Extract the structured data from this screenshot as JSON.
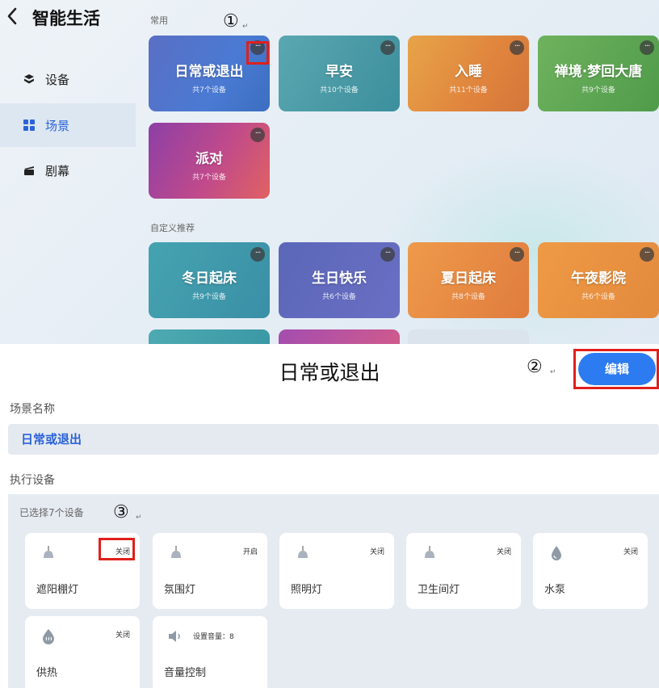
{
  "app": {
    "back_icon": "chevron-left-icon",
    "title": "智能生活"
  },
  "sidebar": {
    "items": [
      {
        "label": "设备",
        "icon": "devices-icon",
        "active": false
      },
      {
        "label": "场景",
        "icon": "scenes-grid-icon",
        "active": true
      },
      {
        "label": "剧幕",
        "icon": "theater-icon",
        "active": false
      }
    ]
  },
  "sections": {
    "common": "常用",
    "custom": "自定义推荐"
  },
  "common_scenes": [
    {
      "title": "日常或退出",
      "subtitle": "共7个设备"
    },
    {
      "title": "早安",
      "subtitle": "共10个设备"
    },
    {
      "title": "入睡",
      "subtitle": "共11个设备"
    },
    {
      "title": "禅境·梦回大唐",
      "subtitle": "共9个设备"
    },
    {
      "title": "派对",
      "subtitle": "共7个设备"
    }
  ],
  "custom_scenes": [
    {
      "title": "冬日起床",
      "subtitle": "共9个设备"
    },
    {
      "title": "生日快乐",
      "subtitle": "共6个设备"
    },
    {
      "title": "夏日起床",
      "subtitle": "共8个设备"
    },
    {
      "title": "午夜影院",
      "subtitle": "共6个设备"
    }
  ],
  "more_icon_text": "···",
  "annotations": {
    "step1": "①",
    "step2": "②",
    "step3": "③",
    "return_mark": "↵"
  },
  "detail": {
    "title": "日常或退出",
    "edit_label": "编辑",
    "scene_name_label": "场景名称",
    "scene_name_value": "日常或退出",
    "exec_devices_label": "执行设备",
    "selected_count": "已选择7个设备",
    "devices": [
      {
        "name": "遮阳棚灯",
        "state": "关闭",
        "icon": "bulb-icon"
      },
      {
        "name": "氛围灯",
        "state": "开启",
        "icon": "bulb-icon"
      },
      {
        "name": "照明灯",
        "state": "关闭",
        "icon": "bulb-icon"
      },
      {
        "name": "卫生间灯",
        "state": "关闭",
        "icon": "bulb-icon"
      },
      {
        "name": "水泵",
        "state": "关闭",
        "icon": "water-drop-icon"
      },
      {
        "name": "供热",
        "state": "关闭",
        "icon": "heating-drop-icon"
      },
      {
        "name": "音量控制",
        "state": "设置音量：8",
        "icon": "speaker-icon"
      }
    ]
  },
  "colors": {
    "accent": "#2d7bf0",
    "highlight_box": "#e0201c",
    "active_text": "#2b63d9"
  }
}
